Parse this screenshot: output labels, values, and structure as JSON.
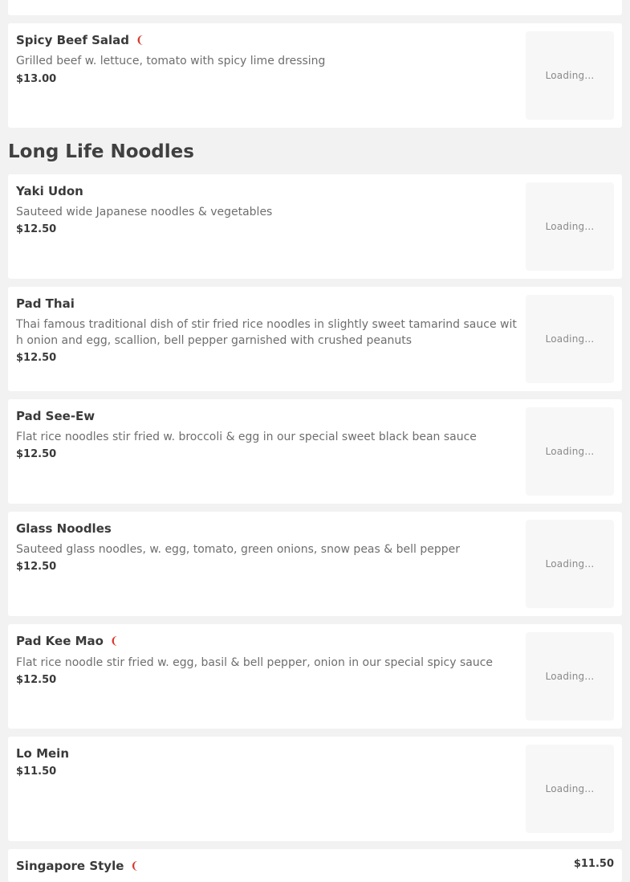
{
  "loading_text": "Loading...",
  "spicy_beef_salad": {
    "name": "Spicy Beef Salad",
    "description": "Grilled beef w. lettuce, tomato with spicy lime dressing",
    "price": "$13.00"
  },
  "section": {
    "title": "Long Life Noodles"
  },
  "items": [
    {
      "name": "Yaki Udon",
      "description": "Sauteed wide Japanese noodles & vegetables",
      "price": "$12.50"
    },
    {
      "name": "Pad Thai",
      "description": "Thai famous traditional dish of stir fried rice noodles in slightly sweet tamarind sauce with onion and egg, scallion, bell pepper garnished with crushed peanuts",
      "price": "$12.50"
    },
    {
      "name": "Pad See-Ew",
      "description": "Flat rice noodles stir fried w. broccoli & egg in our special sweet black bean sauce",
      "price": "$12.50"
    },
    {
      "name": "Glass Noodles",
      "description": "Sauteed glass noodles, w. egg, tomato, green onions, snow peas & bell pepper",
      "price": "$12.50"
    },
    {
      "name": "Pad Kee Mao",
      "description": "Flat rice noodle stir fried w. egg, basil & bell pepper, onion in our special spicy sauce",
      "price": "$12.50"
    },
    {
      "name": "Lo Mein",
      "price": "$11.50"
    },
    {
      "name": "Singapore Style",
      "price": "$11.50"
    }
  ],
  "icons": {
    "spicy": "chili-pepper-icon",
    "spicy_glyph": "❨"
  },
  "colors": {
    "background": "#f2f2f2",
    "card": "#ffffff",
    "thumb": "#f7f7f7",
    "spicy": "#d9382c"
  }
}
